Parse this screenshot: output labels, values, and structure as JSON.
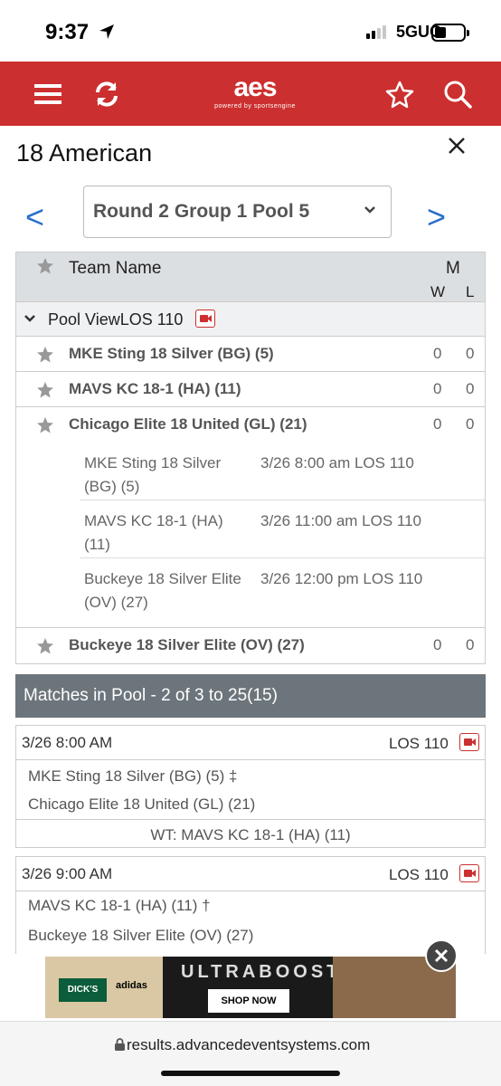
{
  "status_bar": {
    "time": "9:37",
    "network": "5GUC"
  },
  "header": {
    "logo": "aes",
    "logo_sub": "powered by sportsengine",
    "icons": [
      "menu-icon",
      "refresh-icon",
      "star-icon",
      "search-icon"
    ],
    "accent_color": "#cc2f2f"
  },
  "page": {
    "title": "18 American"
  },
  "round_nav": {
    "prev": "<",
    "next": ">",
    "selected": "Round 2 Group 1 Pool 5"
  },
  "pool_table": {
    "col_team": "Team Name",
    "col_m": "M",
    "col_w": "W",
    "col_l": "L",
    "pool_view_label": "Pool ViewLOS 110",
    "teams": [
      {
        "name": "MKE Sting 18 Silver (BG) (5)",
        "w": "0",
        "l": "0"
      },
      {
        "name": "MAVS KC 18-1 (HA) (11)",
        "w": "0",
        "l": "0"
      },
      {
        "name": "Chicago Elite 18 United (GL) (21)",
        "w": "0",
        "l": "0"
      },
      {
        "name": "Buckeye 18 Silver Elite (OV) (27)",
        "w": "0",
        "l": "0"
      }
    ],
    "schedule": [
      {
        "opponent": "MKE Sting 18 Silver (BG) (5)",
        "when": "3/26 8:00 am LOS 110"
      },
      {
        "opponent": "MAVS KC 18-1 (HA) (11)",
        "when": "3/26 11:00 am LOS 110"
      },
      {
        "opponent": "Buckeye 18 Silver Elite (OV) (27)",
        "when": "3/26 12:00 pm LOS 110"
      }
    ]
  },
  "matches": {
    "heading": "Matches in Pool - 2 of 3 to 25(15)",
    "items": [
      {
        "time": "3/26 8:00 AM",
        "court": "LOS 110",
        "team1": "MKE Sting 18 Silver (BG) (5) ‡",
        "team2": "Chicago Elite 18 United (GL) (21)",
        "wt": "WT: MAVS KC 18-1 (HA) (11)"
      },
      {
        "time": "3/26 9:00 AM",
        "court": "LOS 110",
        "team1": "MAVS KC 18-1 (HA) (11) †",
        "team2": "Buckeye 18 Silver Elite (OV) (27)"
      }
    ]
  },
  "ad": {
    "brand": "DICK'S",
    "partner": "adidas",
    "headline": "ULTRABOOST",
    "cta": "SHOP NOW"
  },
  "browser": {
    "url": "results.advancedeventsystems.com"
  }
}
